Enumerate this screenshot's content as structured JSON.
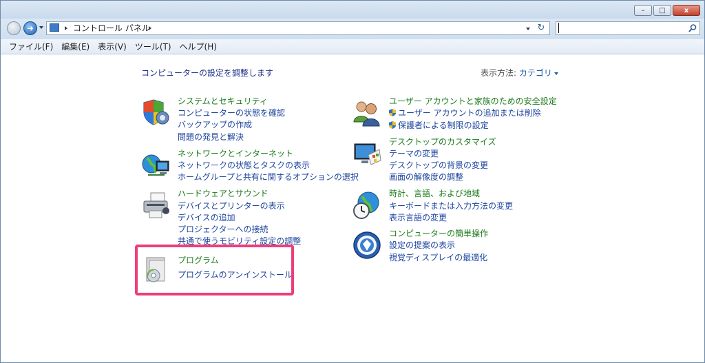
{
  "window": {
    "controls": {
      "minimize": "–",
      "maximize": "□",
      "close": "x"
    }
  },
  "address": {
    "crumbs": [
      "コントロール パネル"
    ],
    "search_placeholder": ""
  },
  "menu": [
    "ファイル(F)",
    "編集(E)",
    "表示(V)",
    "ツール(T)",
    "ヘルプ(H)"
  ],
  "content": {
    "heading": "コンピューターの設定を調整します",
    "view_by_label": "表示方法:",
    "view_by_value": "カテゴリ",
    "categories": [
      {
        "title": "システムとセキュリティ",
        "icon": "shield-icon",
        "links": [
          "コンピューターの状態を確認",
          "バックアップの作成",
          "問題の発見と解決"
        ]
      },
      {
        "title": "ネットワークとインターネット",
        "icon": "network-icon",
        "links": [
          "ネットワークの状態とタスクの表示",
          "ホームグループと共有に関するオプションの選択"
        ]
      },
      {
        "title": "ハードウェアとサウンド",
        "icon": "printer-icon",
        "links": [
          "デバイスとプリンターの表示",
          "デバイスの追加",
          "プロジェクターへの接続",
          "共通で使うモビリティ設定の調整"
        ]
      },
      {
        "title": "プログラム",
        "icon": "programs-icon",
        "links": [
          "プログラムのアンインストール"
        ]
      },
      {
        "title": "ユーザー アカウントと家族のための安全設定",
        "icon": "users-icon",
        "links": [
          "ユーザー アカウントの追加または削除",
          "保護者による制限の設定"
        ]
      },
      {
        "title": "デスクトップのカスタマイズ",
        "icon": "desktop-icon",
        "links": [
          "テーマの変更",
          "デスクトップの背景の変更",
          "画面の解像度の調整"
        ]
      },
      {
        "title": "時計、言語、および地域",
        "icon": "clock-globe-icon",
        "links": [
          "キーボードまたは入力方法の変更",
          "表示言語の変更"
        ]
      },
      {
        "title": "コンピューターの簡単操作",
        "icon": "ease-of-access-icon",
        "links": [
          "設定の提案の表示",
          "視覚ディスプレイの最適化"
        ]
      }
    ]
  }
}
